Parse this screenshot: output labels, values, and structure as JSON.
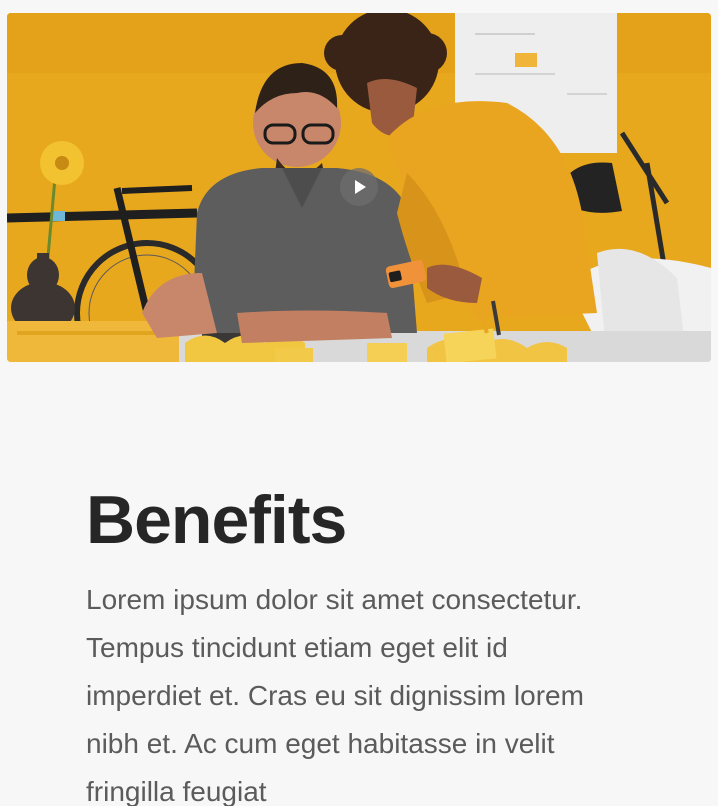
{
  "video": {
    "play_label": "Play video",
    "accent_color": "#e8a81e"
  },
  "benefits": {
    "title": "Benefits",
    "body": "Lorem ipsum dolor sit amet consectetur. Tempus tincidunt etiam eget elit id imperdiet et. Cras eu sit dignissim lorem nibh et. Ac cum eget habitasse in velit fringilla feugiat"
  },
  "colors": {
    "background": "#f7f7f7",
    "heading": "#262626",
    "body_text": "#5b5b5b"
  }
}
